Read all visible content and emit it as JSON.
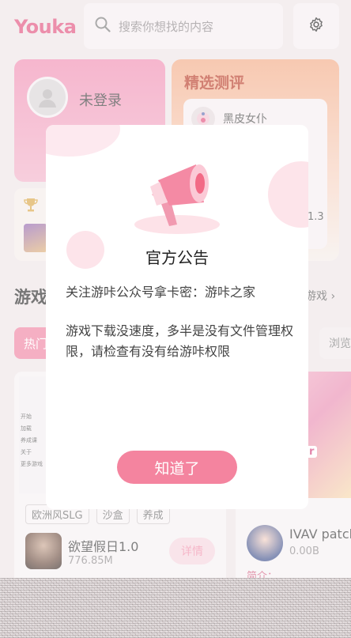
{
  "header": {
    "logo_text": "Youka",
    "search_placeholder": "搜索你想找的内容",
    "search_icon": "search-icon",
    "settings_icon": "gear-icon"
  },
  "user_card": {
    "status": "未登录",
    "avatar_icon": "user-icon"
  },
  "featured": {
    "title": "精选测评",
    "game_name": "黑皮女仆",
    "version_fragment": "1.3"
  },
  "rank_card": {
    "icon": "trophy-icon"
  },
  "section": {
    "title": "游戏",
    "more_link": "游戏"
  },
  "filters": {
    "hot": "热门",
    "browse": "浏览"
  },
  "game_left": {
    "menu_lines": [
      "开始",
      "加载",
      "养成课",
      "关于",
      "更多游戏"
    ],
    "tags": [
      "欧洲风SLG",
      "沙盒",
      "养成"
    ],
    "name": "欲望假日1.0",
    "size": "776.85M",
    "detail_button": "详情"
  },
  "game_right": {
    "name": "IVAV patch",
    "size": "0.00B",
    "intro_label": "简介：",
    "banner_big": "!!",
    "banner_small": "d Gir"
  },
  "dialog": {
    "title": "官方公告",
    "line1": "关注游咔公众号拿卡密：游咔之家",
    "line2": "游戏下载没速度，多半是没有文件管理权限，请检查有没有给游咔权限",
    "confirm_button": "知道了",
    "illustration": "megaphone-icon"
  },
  "colors": {
    "brand": "#e04a78",
    "button": "#f4849f",
    "featured_title": "#b5321d"
  }
}
